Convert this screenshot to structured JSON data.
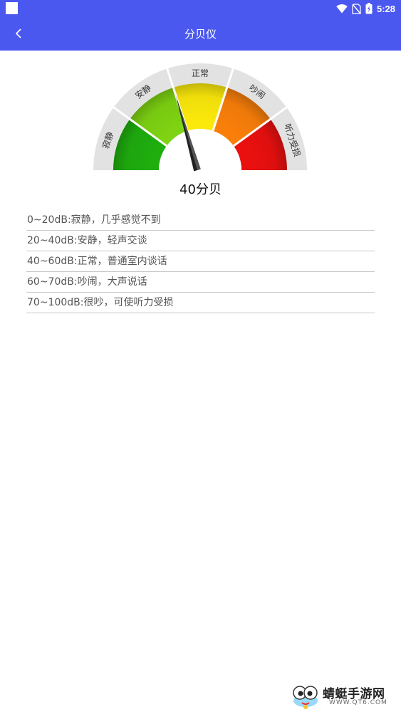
{
  "status_bar": {
    "time": "5:28"
  },
  "app_bar": {
    "title": "分贝仪"
  },
  "gauge": {
    "segments": [
      {
        "label": "寂静",
        "color": "#1fae0e"
      },
      {
        "label": "安静",
        "color": "#7ed312"
      },
      {
        "label": "正常",
        "color": "#fbe90b"
      },
      {
        "label": "吵闹",
        "color": "#fa7f0a"
      },
      {
        "label": "听力受损",
        "color": "#eb1010"
      }
    ],
    "reading_db": 40,
    "reading_text": "40分贝"
  },
  "levels": [
    {
      "text": "0~20dB:寂静，几乎感觉不到"
    },
    {
      "text": "20~40dB:安静，轻声交谈"
    },
    {
      "text": "40~60dB:正常，普通室内谈话"
    },
    {
      "text": "60~70dB:吵闹，大声说话"
    },
    {
      "text": "70~100dB:很吵，可使听力受损"
    }
  ],
  "watermark": {
    "name": "蜻蜓手游网",
    "url": "WWW.QT6.COM"
  },
  "colors": {
    "primary": "#4a58f0"
  }
}
